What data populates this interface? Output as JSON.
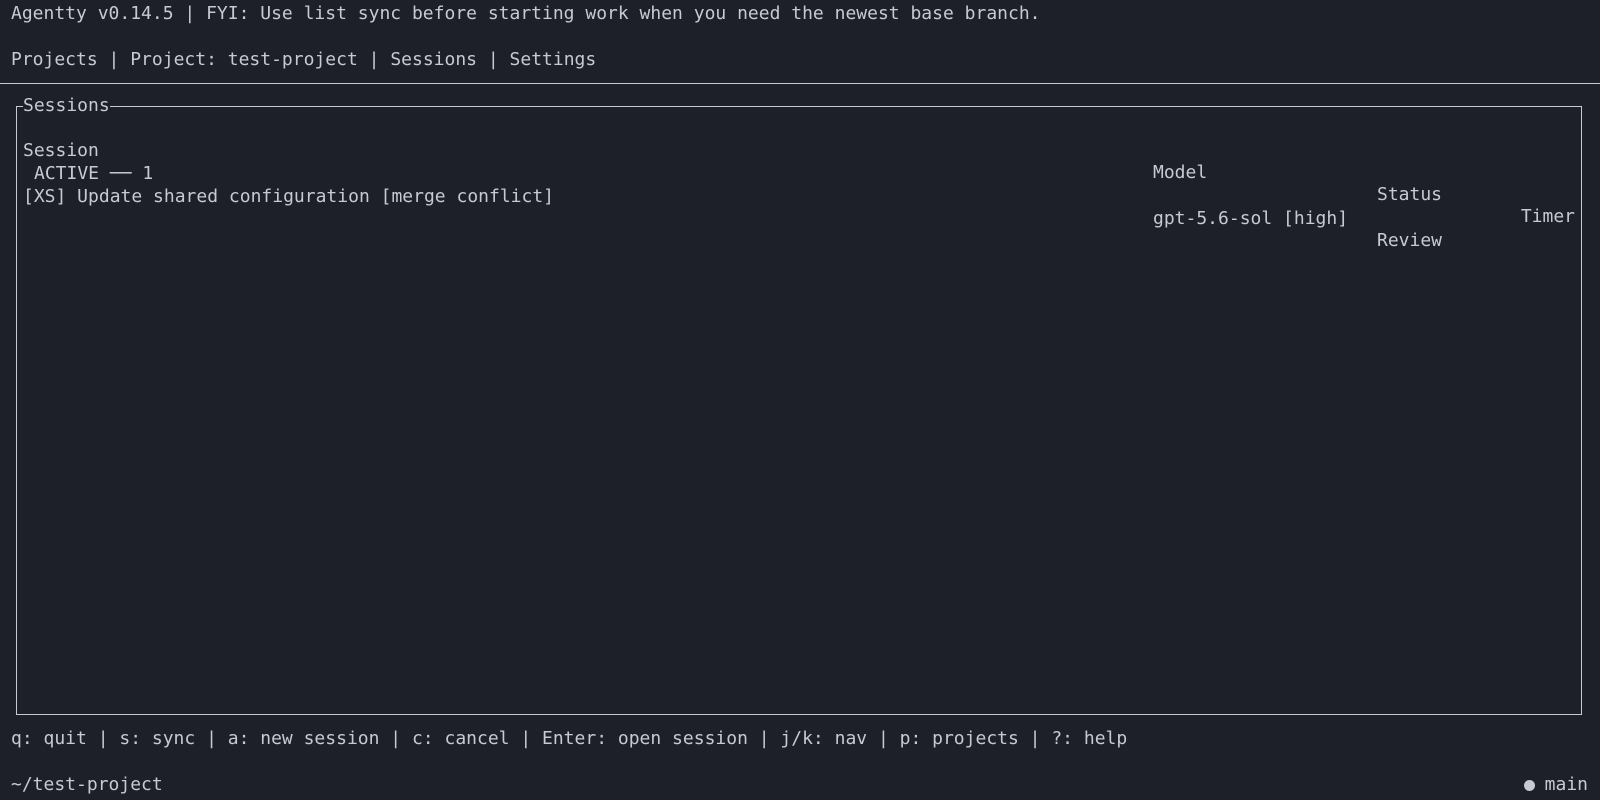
{
  "header": {
    "banner": "Agentty v0.14.5 | FYI: Use list sync before starting work when you need the newest base branch."
  },
  "nav": {
    "items": [
      {
        "label": "Projects"
      },
      {
        "label": "Project: test-project"
      },
      {
        "label": "Sessions"
      },
      {
        "label": "Settings"
      }
    ],
    "separator": " | "
  },
  "sessions_panel": {
    "title": "Sessions",
    "columns": {
      "session": "Session",
      "model": "Model",
      "status": "Status",
      "timer": "Timer"
    },
    "group": {
      "label": "ACTIVE ── 1"
    },
    "rows": [
      {
        "session": "[XS] Update shared configuration [merge conflict]",
        "model": "gpt-5.6-sol [high]",
        "status": "Review",
        "timer": ""
      }
    ]
  },
  "footer": {
    "shortcuts": "q: quit | s: sync | a: new session | c: cancel | Enter: open session | j/k: nav | p: projects | ?: help",
    "path": "~/test-project",
    "branch": "main"
  },
  "colors": {
    "background": "#1e2029",
    "foreground": "#c8cad1"
  }
}
